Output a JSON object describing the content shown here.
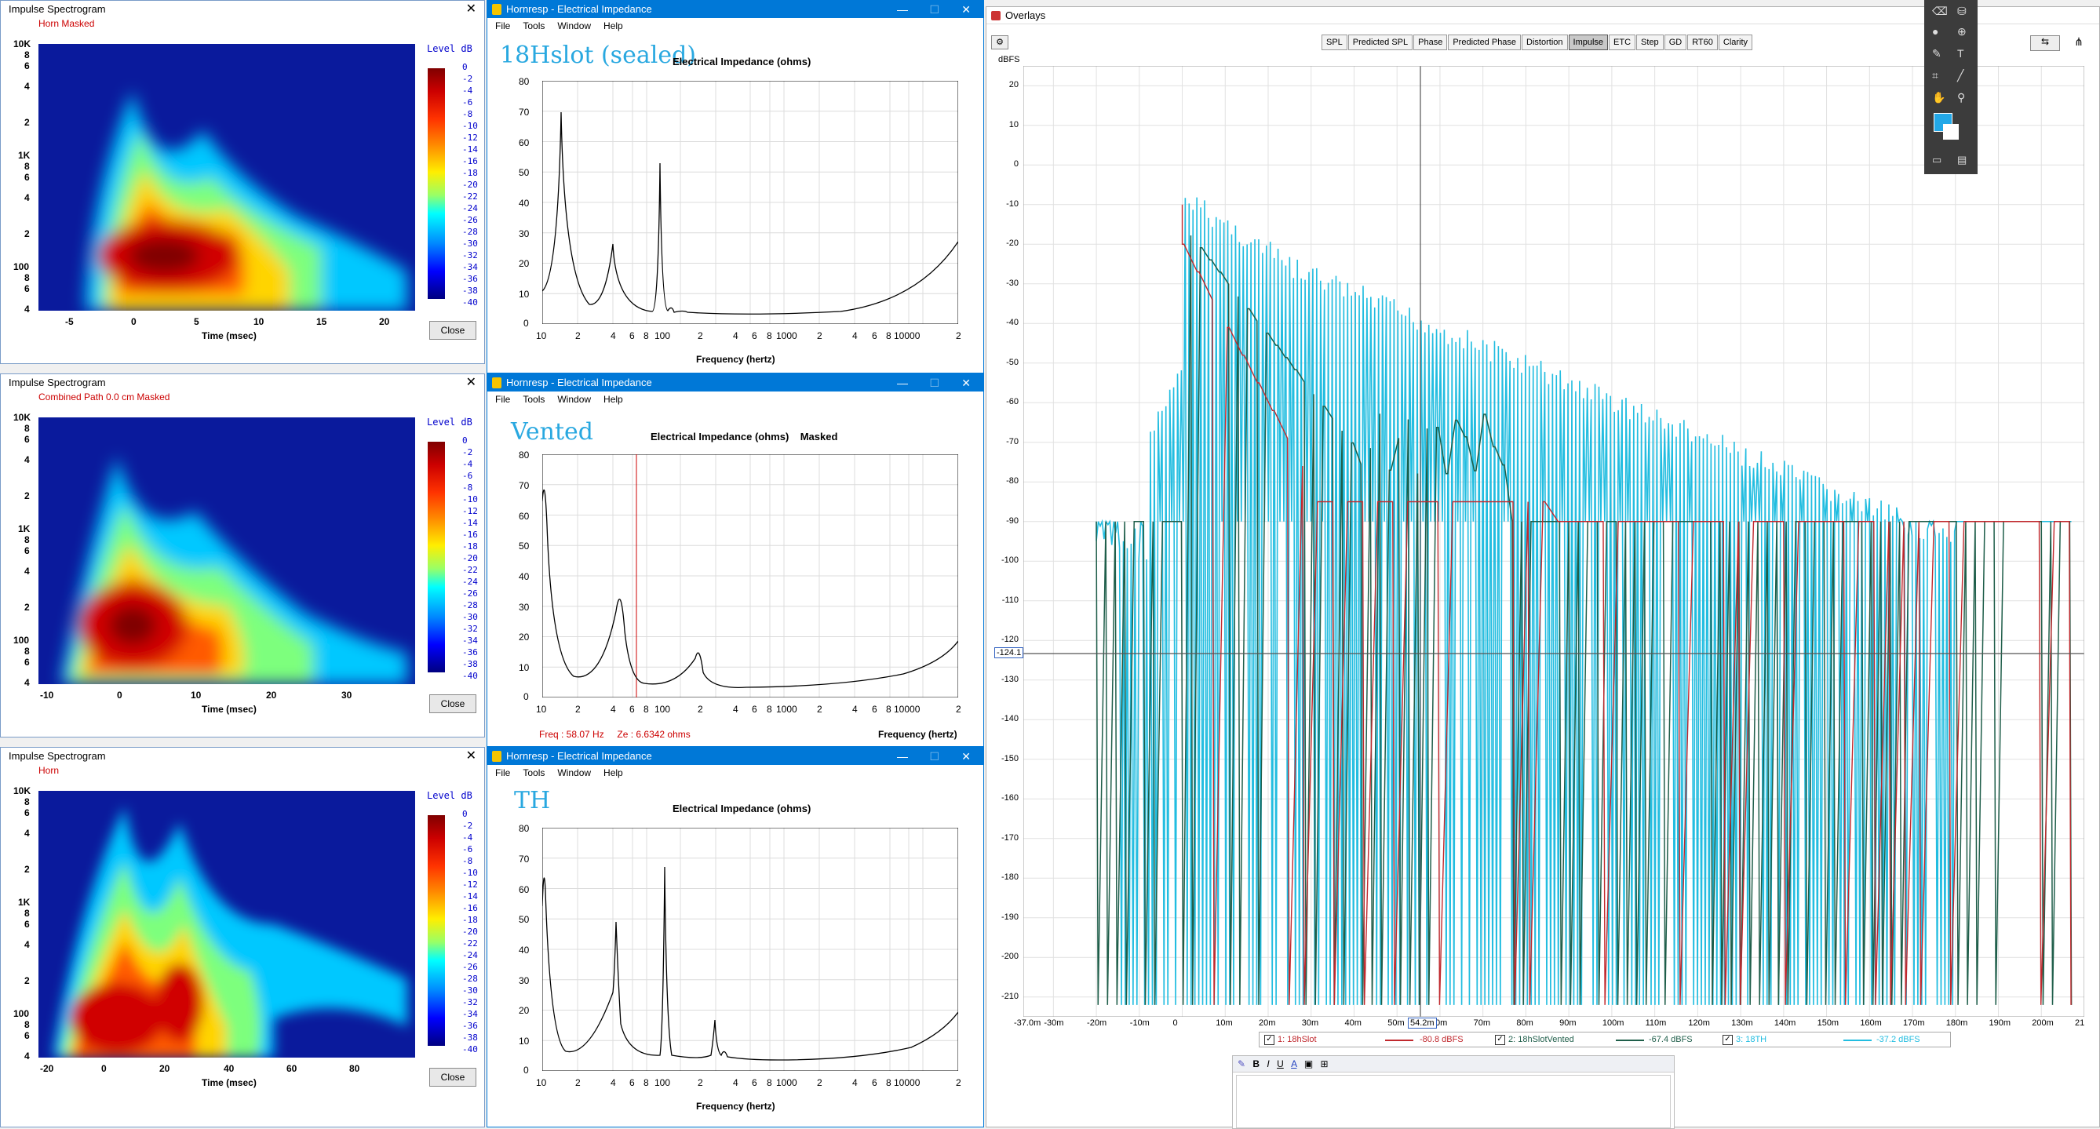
{
  "spectrograms": [
    {
      "title": "Impulse Spectrogram",
      "header": "Horn    Masked",
      "close": "Close",
      "level_label": "Level  dB",
      "xlabel": "Time (msec)",
      "xticks": [
        "-5",
        "0",
        "5",
        "10",
        "15",
        "20"
      ],
      "yticks": [
        "10K",
        "8",
        "6",
        "4",
        "2",
        "1K",
        "8",
        "6",
        "4",
        "2",
        "100",
        "8",
        "6",
        "4"
      ]
    },
    {
      "title": "Impulse Spectrogram",
      "header": "Combined  Path 0.0 cm    Masked",
      "close": "Close",
      "level_label": "Level  dB",
      "xlabel": "Time (msec)",
      "xticks": [
        "-10",
        "0",
        "10",
        "20",
        "30"
      ],
      "yticks": [
        "10K",
        "8",
        "6",
        "4",
        "2",
        "1K",
        "8",
        "6",
        "4",
        "2",
        "100",
        "8",
        "6",
        "4"
      ]
    },
    {
      "title": "Impulse Spectrogram",
      "header": "Horn",
      "close": "Close",
      "level_label": "Level  dB",
      "xlabel": "Time (msec)",
      "xticks": [
        "-20",
        "0",
        "20",
        "40",
        "60",
        "80"
      ],
      "yticks": [
        "10K",
        "8",
        "6",
        "4",
        "2",
        "1K",
        "8",
        "6",
        "4",
        "2",
        "100",
        "8",
        "6",
        "4"
      ]
    }
  ],
  "colorbar_ticks": [
    "0",
    "-2",
    "-4",
    "-6",
    "-8",
    "-10",
    "-12",
    "-14",
    "-16",
    "-18",
    "-20",
    "-22",
    "-24",
    "-26",
    "-28",
    "-30",
    "-32",
    "-34",
    "-36",
    "-38",
    "-40"
  ],
  "impedance": [
    {
      "title": "Hornresp - Electrical Impedance",
      "menu": [
        "File",
        "Tools",
        "Window",
        "Help"
      ],
      "big_label": "18Hslot (sealed)",
      "caption": "Electrical Impedance (ohms)",
      "xlabel": "Frequency (hertz)",
      "readout": ""
    },
    {
      "title": "Hornresp - Electrical Impedance",
      "menu": [
        "File",
        "Tools",
        "Window",
        "Help"
      ],
      "big_label": "Vented",
      "caption": "Electrical Impedance (ohms)    Masked",
      "xlabel": "Frequency (hertz)",
      "readout": "Freq : 58.07 Hz     Ze : 6.6342 ohms"
    },
    {
      "title": "Hornresp - Electrical Impedance",
      "menu": [
        "File",
        "Tools",
        "Window",
        "Help"
      ],
      "big_label": "TH",
      "caption": "Electrical Impedance (ohms)",
      "xlabel": "Frequency (hertz)",
      "readout": ""
    }
  ],
  "imp_xticks": [
    "10",
    "2",
    "4",
    "6",
    "8",
    "100",
    "2",
    "4",
    "6",
    "8",
    "1000",
    "2",
    "4",
    "6",
    "8",
    "10000",
    "2"
  ],
  "imp_yticks": [
    "80",
    "70",
    "60",
    "50",
    "40",
    "30",
    "20",
    "10",
    "0"
  ],
  "overlay": {
    "title": "Overlays",
    "tabs": [
      "SPL",
      "Predicted SPL",
      "Phase",
      "Predicted Phase",
      "Distortion",
      "Impulse",
      "ETC",
      "Step",
      "GD",
      "RT60",
      "Clarity"
    ],
    "active_tab": "Impulse",
    "unit": "dBFS",
    "yticks": [
      "20",
      "10",
      "0",
      "-10",
      "-20",
      "-30",
      "-40",
      "-50",
      "-60",
      "-70",
      "-80",
      "-90",
      "-100",
      "-110",
      "-120",
      "-130",
      "-140",
      "-150",
      "-160",
      "-170",
      "-180",
      "-190",
      "-200",
      "-210"
    ],
    "xticks": [
      "-37.0m",
      "-30m",
      "-20m",
      "-10m",
      "0",
      "10m",
      "20m",
      "30m",
      "40m",
      "50m",
      "60m",
      "70m",
      "80m",
      "90m",
      "100m",
      "110m",
      "120m",
      "130m",
      "140m",
      "150m",
      "160m",
      "170m",
      "180m",
      "190m",
      "200m",
      "21"
    ],
    "cursor_y": "-124.1",
    "cursor_x": "54.2m",
    "legend": [
      {
        "label": "1: 18hSlot",
        "value": "-80.8 dBFS",
        "color": "#c0282d"
      },
      {
        "label": "2: 18hSlotVented",
        "value": "-67.4 dBFS",
        "color": "#1f5e4a"
      },
      {
        "label": "3: 18TH",
        "value": "-37.2 dBFS",
        "color": "#22bde0"
      }
    ]
  },
  "notes_toolbar": [
    "B",
    "I",
    "U",
    "A"
  ]
}
